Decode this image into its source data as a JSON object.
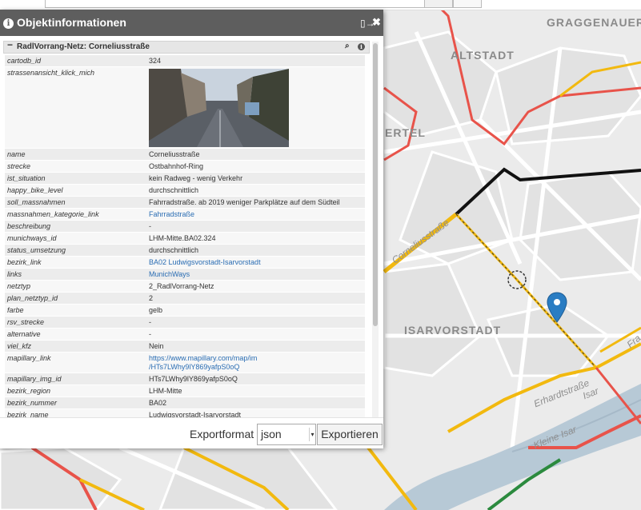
{
  "map": {
    "districts": [
      "GRAGGENAUER",
      "ALTSTADT",
      "ERTEL",
      "ISARVORSTADT"
    ],
    "streets": [
      "Corneliusstraße",
      "Erhardtstraße",
      "Kleine Isar",
      "Isar",
      "Fra"
    ],
    "colors": {
      "route_yellow": "#f2b90f",
      "route_red": "#e8534a",
      "route_black": "#111111",
      "route_green": "#2b8a3e",
      "marker": "#2a7dc3",
      "water": "#b7c9d6"
    },
    "marker_icon": "map-pin-icon"
  },
  "panel": {
    "title": "Objektinformationen",
    "header_icon": "info-icon",
    "detach_icon": "detach-icon",
    "close_icon": "close-icon",
    "group": {
      "title": "RadlVorrang-Netz: Corneliusstraße",
      "collapse_icon": "minus-icon",
      "zoom_icon": "zoom-icon",
      "info_icon": "info-icon"
    },
    "attributes": [
      {
        "key": "cartodb_id",
        "value": "324"
      },
      {
        "key": "strassenansicht_klick_mich",
        "value": "",
        "image": true
      },
      {
        "key": "name",
        "value": "Corneliusstraße"
      },
      {
        "key": "strecke",
        "value": "Ostbahnhof-Ring"
      },
      {
        "key": "ist_situation",
        "value": "kein Radweg - wenig Verkehr"
      },
      {
        "key": "happy_bike_level",
        "value": "durchschnittlich"
      },
      {
        "key": "soll_massnahmen",
        "value": "Fahrradstraße. ab 2019 weniger Parkplätze auf dem Südteil"
      },
      {
        "key": "massnahmen_kategorie_link",
        "value": "Fahrradstraße",
        "link": true
      },
      {
        "key": "beschreibung",
        "value": "-"
      },
      {
        "key": "munichways_id",
        "value": "LHM-Mitte.BA02.324"
      },
      {
        "key": "status_umsetzung",
        "value": "durchschnittlich"
      },
      {
        "key": "bezirk_link",
        "value": "BA02 Ludwigsvorstadt-Isarvorstadt",
        "link": true
      },
      {
        "key": "links",
        "value": "MunichWays",
        "link": true
      },
      {
        "key": "netztyp",
        "value": "2_RadlVorrang-Netz"
      },
      {
        "key": "plan_netztyp_id",
        "value": "2"
      },
      {
        "key": "farbe",
        "value": "gelb"
      },
      {
        "key": "rsv_strecke",
        "value": "-"
      },
      {
        "key": "alternative",
        "value": "-"
      },
      {
        "key": "viel_kfz",
        "value": "Nein"
      },
      {
        "key": "mapillary_link",
        "value": "https://www.mapillary.com/map/im",
        "value2": "/HTs7LWhy9lY869yafpS0oQ",
        "link": true
      },
      {
        "key": "mapillary_img_id",
        "value": "HTs7LWhy9lY869yafpS0oQ"
      },
      {
        "key": "bezirk_region",
        "value": "LHM-Mitte"
      },
      {
        "key": "bezirk_nummer",
        "value": "BA02"
      },
      {
        "key": "bezirk_name",
        "value": "Ludwigsvorstadt-Isarvorstadt"
      }
    ],
    "footer": {
      "export_label": "Exportformat",
      "format_value": "json",
      "export_button": "Exportieren"
    }
  }
}
